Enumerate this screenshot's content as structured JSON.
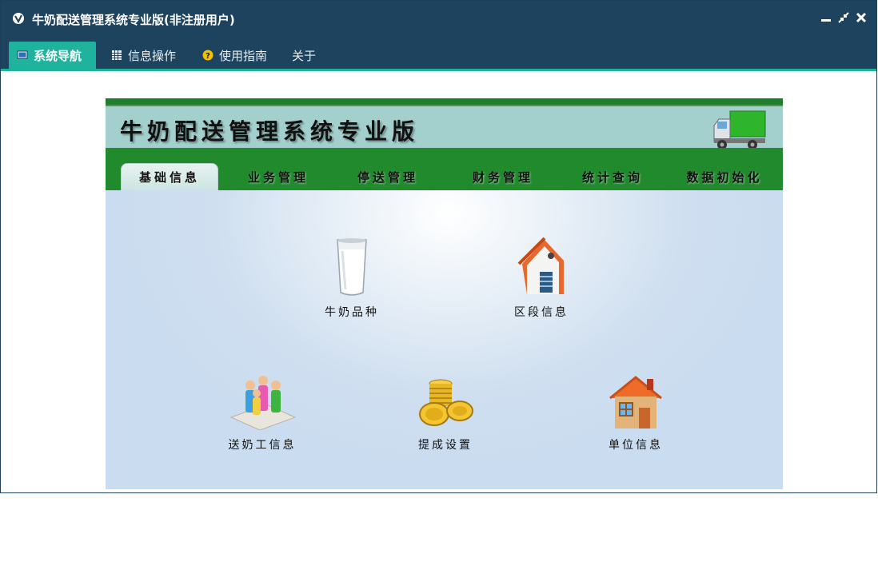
{
  "window": {
    "title": "牛奶配送管理系统专业版(非注册用户)"
  },
  "menu": {
    "tabs": [
      {
        "label": "系统导航"
      },
      {
        "label": "信息操作"
      },
      {
        "label": "使用指南"
      },
      {
        "label": "关于"
      }
    ]
  },
  "panel": {
    "title": "牛奶配送管理系统专业版",
    "nav_tabs": [
      {
        "label": "基础信息"
      },
      {
        "label": "业务管理"
      },
      {
        "label": "停送管理"
      },
      {
        "label": "财务管理"
      },
      {
        "label": "统计查询"
      },
      {
        "label": "数据初始化"
      }
    ],
    "tiles": [
      {
        "label": "牛奶品种",
        "icon": "milk-glass-icon"
      },
      {
        "label": "区段信息",
        "icon": "building-icon"
      },
      {
        "label": "送奶工信息",
        "icon": "people-icon"
      },
      {
        "label": "提成设置",
        "icon": "gold-coins-icon"
      },
      {
        "label": "单位信息",
        "icon": "house-icon"
      }
    ]
  },
  "colors": {
    "titlebar": "#1e435f",
    "accent": "#1fb39e",
    "header_band": "#a3d0cc",
    "nav_green": "#208a2d"
  }
}
